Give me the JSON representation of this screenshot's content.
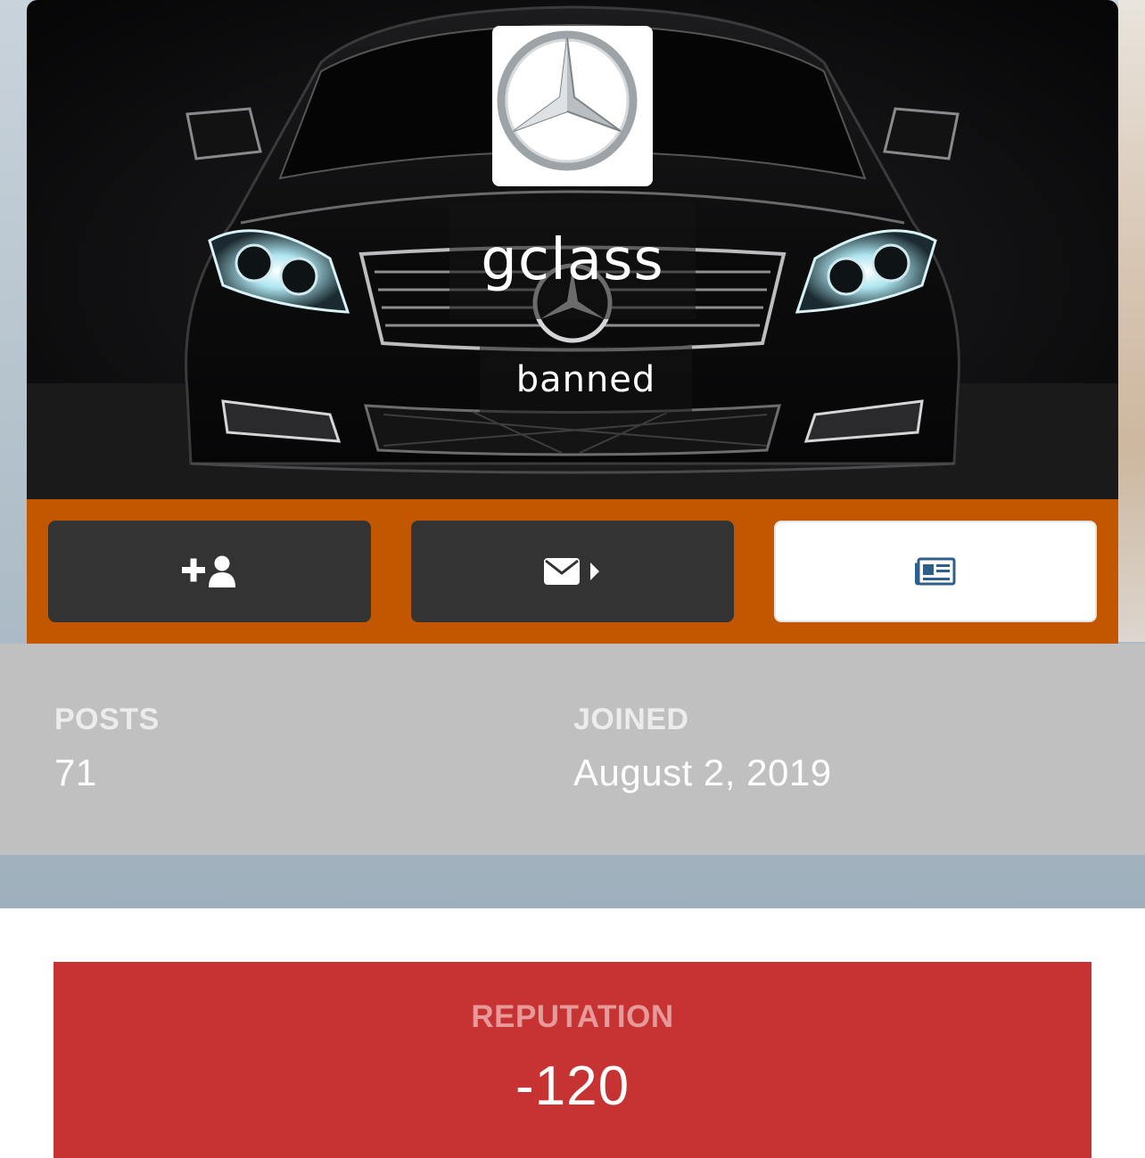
{
  "profile": {
    "username": "gclass",
    "group": "banned",
    "avatar_icon": "mercedes-star-logo",
    "cover_image": "black-mercedes-car-front"
  },
  "actions": {
    "follow_icon": "user-plus-icon",
    "message_icon": "envelope-icon",
    "content_icon": "newspaper-icon"
  },
  "stats": {
    "posts_label": "POSTS",
    "posts_value": "71",
    "joined_label": "JOINED",
    "joined_value": "August 2, 2019"
  },
  "reputation": {
    "label": "REPUTATION",
    "value": "-120"
  },
  "colors": {
    "action_bar": "#c25700",
    "reputation_negative": "#c73232",
    "content_icon": "#2d5f8a"
  }
}
